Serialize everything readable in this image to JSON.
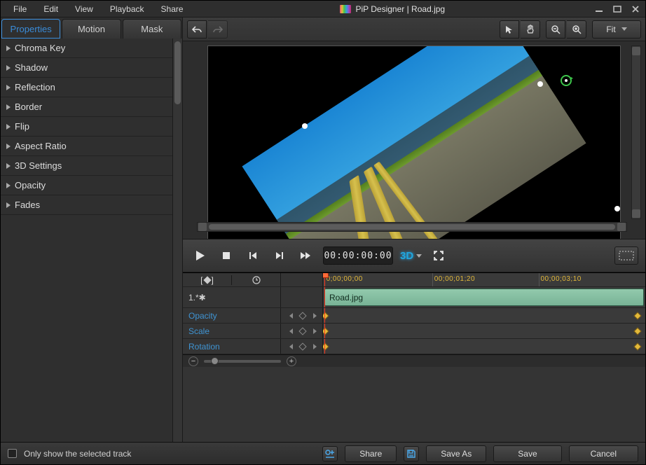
{
  "title": "PiP Designer | Road.jpg",
  "menu": {
    "file": "File",
    "edit": "Edit",
    "view": "View",
    "playback": "Playback",
    "share": "Share"
  },
  "tabs": {
    "properties": "Properties",
    "motion": "Motion",
    "mask": "Mask"
  },
  "sections": [
    "Chroma Key",
    "Shadow",
    "Reflection",
    "Border",
    "Flip",
    "Aspect Ratio",
    "3D Settings",
    "Opacity",
    "Fades"
  ],
  "toolbar": {
    "fit": "Fit"
  },
  "playback": {
    "timecode": "00:00:00:00",
    "three_d": "3D"
  },
  "timeline": {
    "ticks": [
      "0;00;00;00",
      "00;00;01;20",
      "00;00;03;10"
    ],
    "track_label": "1.*✱",
    "clip_name": "Road.jpg",
    "tracks": [
      "Opacity",
      "Scale",
      "Rotation"
    ]
  },
  "footer": {
    "only_show": "Only show the selected track",
    "share": "Share",
    "save_as": "Save As",
    "save": "Save",
    "cancel": "Cancel"
  }
}
